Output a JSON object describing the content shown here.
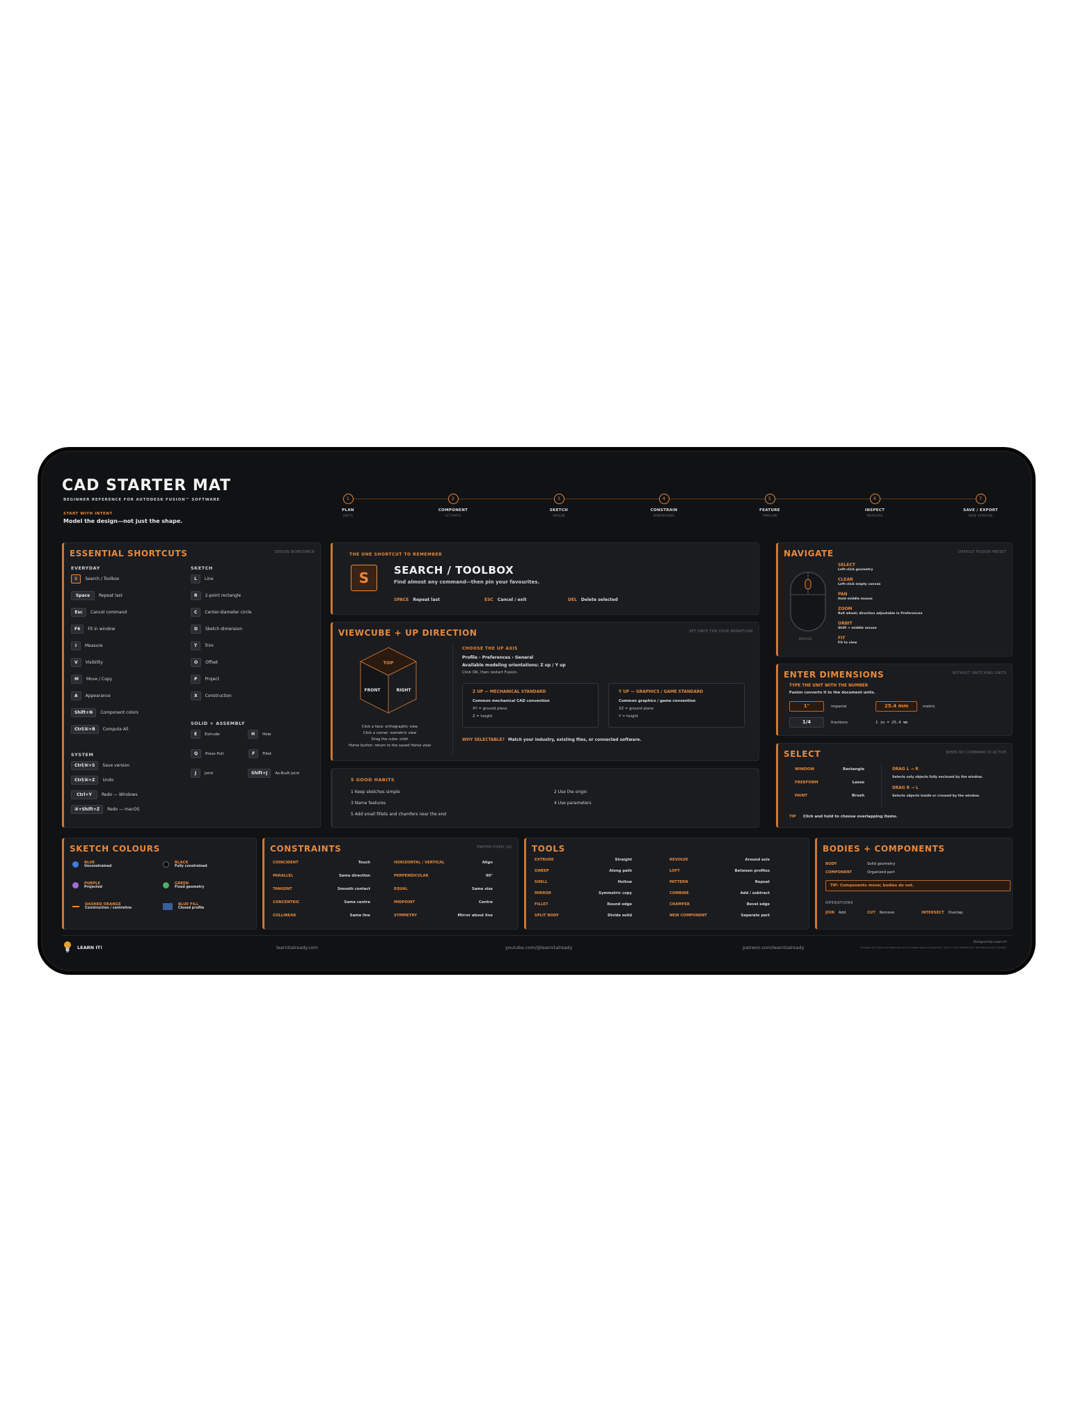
{
  "header": {
    "title": "CAD STARTER MAT",
    "subtitle": "BEGINNER REFERENCE FOR AUTODESK FUSION™ SOFTWARE",
    "intent_label": "START WITH INTENT",
    "intent_text": "Model the design—not just the shape."
  },
  "steps": [
    {
      "num": "1",
      "name": "PLAN",
      "sub": "UNITS"
    },
    {
      "num": "2",
      "name": "COMPONENT",
      "sub": "ACTIVATE"
    },
    {
      "num": "3",
      "name": "SKETCH",
      "sub": "ORIGIN"
    },
    {
      "num": "4",
      "name": "CONSTRAIN",
      "sub": "DIMENSIONS"
    },
    {
      "num": "5",
      "name": "FEATURE",
      "sub": "TIMELINE"
    },
    {
      "num": "6",
      "name": "INSPECT",
      "sub": "MEASURE"
    },
    {
      "num": "7",
      "name": "SAVE / EXPORT",
      "sub": "NEW VERSION"
    }
  ],
  "shortcuts": {
    "title": "ESSENTIAL SHORTCUTS",
    "note": "DESIGN WORKSPACE",
    "everyday_label": "EVERYDAY",
    "everyday": [
      {
        "key": "S",
        "label": "Search / Toolbox"
      },
      {
        "key": "Space",
        "label": "Repeat last"
      },
      {
        "key": "Esc",
        "label": "Cancel command"
      },
      {
        "key": "F6",
        "label": "Fit in window"
      },
      {
        "key": "I",
        "label": "Measure"
      },
      {
        "key": "V",
        "label": "Visibility"
      },
      {
        "key": "M",
        "label": "Move / Copy"
      },
      {
        "key": "A",
        "label": "Appearance"
      },
      {
        "key": "Shift+N",
        "label": "Component colors"
      },
      {
        "key": "Ctrl/⌘+B",
        "label": "Compute All"
      }
    ],
    "sketch_label": "SKETCH",
    "sketch": [
      {
        "key": "L",
        "label": "Line"
      },
      {
        "key": "R",
        "label": "2-point rectangle"
      },
      {
        "key": "C",
        "label": "Center-diameter circle"
      },
      {
        "key": "D",
        "label": "Sketch dimension"
      },
      {
        "key": "T",
        "label": "Trim"
      },
      {
        "key": "O",
        "label": "Offset"
      },
      {
        "key": "P",
        "label": "Project"
      },
      {
        "key": "X",
        "label": "Construction"
      }
    ],
    "solid_label": "SOLID + ASSEMBLY",
    "solid": [
      {
        "key": "E",
        "label": "Extrude",
        "key2": "H",
        "label2": "Hole"
      },
      {
        "key": "Q",
        "label": "Press Pull",
        "key2": "F",
        "label2": "Fillet"
      },
      {
        "key": "J",
        "label": "Joint",
        "key2": "Shift+J",
        "label2": "As-Built Joint"
      }
    ],
    "system_label": "SYSTEM",
    "system": [
      {
        "key": "Ctrl/⌘+S",
        "label": "Save version"
      },
      {
        "key": "Ctrl/⌘+Z",
        "label": "Undo"
      },
      {
        "key": "Ctrl+Y",
        "label": "Redo — Windows"
      },
      {
        "key": "⌘+Shift+Z",
        "label": "Redo — macOS"
      }
    ]
  },
  "search": {
    "label": "THE ONE SHORTCUT TO REMEMBER",
    "key": "S",
    "title": "SEARCH / TOOLBOX",
    "desc": "Find almost any command—then pin your favourites.",
    "hints": [
      {
        "k": "SPACE",
        "v": "Repeat last"
      },
      {
        "k": "ESC",
        "v": "Cancel / exit"
      },
      {
        "k": "DEL",
        "v": "Delete selected"
      }
    ]
  },
  "viewcube": {
    "title": "VIEWCUBE + UP DIRECTION",
    "note": "SET ONCE FOR YOUR WORKFLOW",
    "faces": {
      "top": "TOP",
      "front": "FRONT",
      "right": "RIGHT"
    },
    "tips": [
      "Click a face: orthographic view",
      "Click a corner: isometric view",
      "Drag the cube: orbit",
      "Home button: return to the saved Home view"
    ],
    "up_label": "CHOOSE THE UP AXIS",
    "up_path": "Profile › Preferences › General",
    "up_orient": "Available modeling orientations: Z up / Y up",
    "up_ok": "Click OK, then restart Fusion.",
    "z_title": "Z UP — MECHANICAL STANDARD",
    "z_lines": [
      "Common mechanical CAD convention",
      "XY = ground plane",
      "Z = height"
    ],
    "y_title": "Y UP — GRAPHICS / GAME STANDARD",
    "y_lines": [
      "Common graphics / game convention",
      "XZ = ground plane",
      "Y = height"
    ],
    "why_label": "WHY SELECTABLE?",
    "why_text": "Match your industry, existing files, or connected software."
  },
  "habits": {
    "title": "5 GOOD HABITS",
    "items": [
      "1 Keep sketches simple",
      "2 Use the origin",
      "3 Name features",
      "4 Use parameters",
      "5 Add small fillets and chamfers near the end"
    ]
  },
  "navigate": {
    "title": "NAVIGATE",
    "note": "DEFAULT FUSION PRESET",
    "mouse_label": "MOUSE",
    "items": [
      {
        "k": "SELECT",
        "v": "Left-click geometry"
      },
      {
        "k": "CLEAR",
        "v": "Left-click empty canvas"
      },
      {
        "k": "PAN",
        "v": "Hold middle mouse"
      },
      {
        "k": "ZOOM",
        "v": "Roll wheel; direction adjustable in Preferences"
      },
      {
        "k": "ORBIT",
        "v": "Shift + middle mouse"
      },
      {
        "k": "FIT",
        "v": "Fit to view"
      }
    ]
  },
  "dimensions": {
    "title": "ENTER DIMENSIONS",
    "note": "WITHOUT SWITCHING UNITS",
    "label": "TYPE THE UNIT WITH THE NUMBER",
    "desc": "Fusion converts it to the document units.",
    "ex1": "1\"",
    "ex1_label": "imperial",
    "ex2": "25.4 mm",
    "ex2_label": "metric",
    "ex3": "1/4",
    "ex3_label": "fractions",
    "ex4": "1 in = 25.4 mm"
  },
  "select": {
    "title": "SELECT",
    "note": "WHEN NO COMMAND IS ACTIVE",
    "modes": [
      {
        "k": "WINDOW",
        "v": "Rectangle"
      },
      {
        "k": "FREEFORM",
        "v": "Lasso"
      },
      {
        "k": "PAINT",
        "v": "Brush"
      }
    ],
    "drag_lr": "DRAG L → R",
    "drag_lr_text": "Selects only objects fully enclosed by the window.",
    "drag_rl": "DRAG R → L",
    "drag_rl_text": "Selects objects inside or crossed by the window.",
    "tip_label": "TIP",
    "tip_text": "Click and hold to choose overlapping items."
  },
  "colours": {
    "title": "SKETCH COLOURS",
    "items": [
      {
        "name": "BLUE",
        "desc": "Unconstrained",
        "color": "#3d7fe0"
      },
      {
        "name": "BLACK",
        "desc": "Fully constrained",
        "color": "#0a0a0a"
      },
      {
        "name": "PURPLE",
        "desc": "Projected",
        "color": "#a66ad8"
      },
      {
        "name": "GREEN",
        "desc": "Fixed geometry",
        "color": "#4caf62"
      },
      {
        "name": "DASHED ORANGE",
        "desc": "Construction / centreline",
        "color": "#e8893a"
      },
      {
        "name": "BLUE FILL",
        "desc": "Closed profile",
        "color": "#3a5e96"
      }
    ]
  },
  "constraints": {
    "title": "CONSTRAINTS",
    "note": "PREFER FIXED (IS)",
    "left": [
      {
        "k": "COINCIDENT",
        "v": "Touch"
      },
      {
        "k": "PARALLEL",
        "v": "Same direction"
      },
      {
        "k": "TANGENT",
        "v": "Smooth contact"
      },
      {
        "k": "CONCENTRIC",
        "v": "Same centre"
      },
      {
        "k": "COLLINEAR",
        "v": "Same line"
      }
    ],
    "right": [
      {
        "k": "HORIZONTAL / VERTICAL",
        "v": "Align"
      },
      {
        "k": "PERPENDICULAR",
        "v": "90°"
      },
      {
        "k": "EQUAL",
        "v": "Same size"
      },
      {
        "k": "MIDPOINT",
        "v": "Centre"
      },
      {
        "k": "SYMMETRY",
        "v": "Mirror about line"
      }
    ]
  },
  "tools": {
    "title": "TOOLS",
    "left": [
      {
        "k": "EXTRUDE",
        "v": "Straight"
      },
      {
        "k": "SWEEP",
        "v": "Along path"
      },
      {
        "k": "SHELL",
        "v": "Hollow"
      },
      {
        "k": "MIRROR",
        "v": "Symmetric copy"
      },
      {
        "k": "FILLET",
        "v": "Round edge"
      },
      {
        "k": "SPLIT BODY",
        "v": "Divide solid"
      }
    ],
    "right": [
      {
        "k": "REVOLVE",
        "v": "Around axis"
      },
      {
        "k": "LOFT",
        "v": "Between profiles"
      },
      {
        "k": "PATTERN",
        "v": "Repeat"
      },
      {
        "k": "COMBINE",
        "v": "Add / subtract"
      },
      {
        "k": "CHAMFER",
        "v": "Bevel edge"
      },
      {
        "k": "NEW COMPONENT",
        "v": "Separate part"
      }
    ]
  },
  "bodies": {
    "title": "BODIES + COMPONENTS",
    "rows": [
      {
        "k": "BODY",
        "v": "Solid geometry"
      },
      {
        "k": "COMPONENT",
        "v": "Organized part"
      }
    ],
    "tip": "TIP: Components move; bodies do not.",
    "ops_label": "OPERATIONS",
    "ops": [
      {
        "k": "JOIN",
        "v": "Add"
      },
      {
        "k": "CUT",
        "v": "Remove"
      },
      {
        "k": "INTERSECT",
        "v": "Overlap"
      }
    ]
  },
  "footer": {
    "brand": "LEARN IT!",
    "links": [
      "learnitalready.com",
      "youtube.com/@learnitalready",
      "patreon.com/learnitalready"
    ],
    "credit": "Designed by Learn It!",
    "legal": "Autodesk and Fusion are trademarks of the Autodesk group of companies; used in a non-affiliated way. Not affiliated with Autodesk."
  }
}
